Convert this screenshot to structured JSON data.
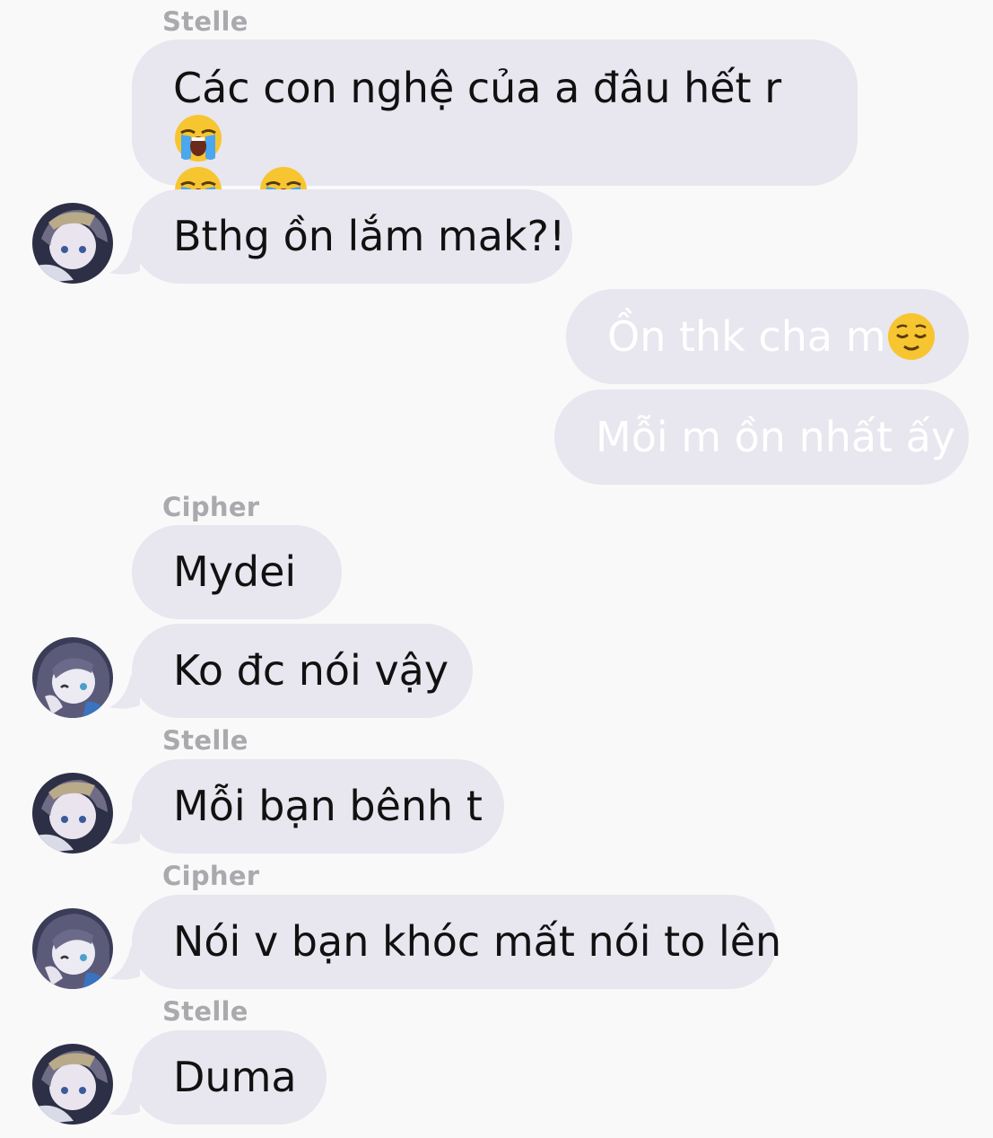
{
  "messages": [
    {
      "sender": "Stelle",
      "text_line1": "Các con nghệ của a đâu hết r",
      "emoji_after_line1": "loudly-crying-face-emoji",
      "line2_emojis": [
        "loudly-crying-face-emoji",
        "loudly-crying-face-emoji"
      ]
    },
    {
      "text": "Bthg ồn lắm mak?!",
      "avatar": "stelle-avatar"
    },
    {
      "text": "Ồn thk cha m",
      "emoji": "relieved-face-emoji",
      "outgoing": true
    },
    {
      "text": "Mỗi m ồn nhất ấy",
      "outgoing": true
    },
    {
      "sender": "Cipher",
      "text": "Mydei"
    },
    {
      "text": "Ko đc nói vậy",
      "avatar": "cipher-avatar"
    },
    {
      "sender": "Stelle",
      "text": "Mỗi bạn bênh t",
      "avatar": "stelle-avatar"
    },
    {
      "sender": "Cipher",
      "text": "Nói v bạn khóc mất nói to lên",
      "avatar": "cipher-avatar"
    },
    {
      "sender": "Stelle",
      "text": "Duma",
      "avatar": "stelle-avatar"
    }
  ],
  "colors": {
    "background": "#f9f9f9",
    "bubble": "#e8e6ee",
    "sender_name": "#a9a9ae",
    "incoming_text": "#111111",
    "outgoing_text": "#ffffff"
  }
}
